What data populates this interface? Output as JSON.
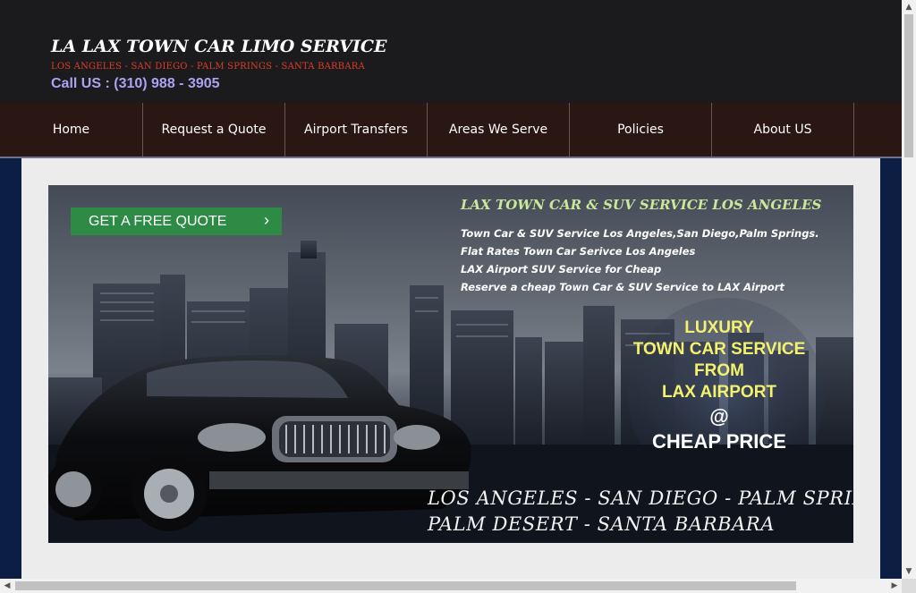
{
  "header": {
    "title": "LA LAX TOWN CAR LIMO SERVICE",
    "subtitle": "LOS ANGELES - SAN DIEGO - PALM SPRINGS - SANTA BARBARA",
    "phone": "Call US : (310) 988 - 3905"
  },
  "nav": {
    "items": [
      {
        "label": "Home"
      },
      {
        "label": "Request a Quote"
      },
      {
        "label": "Airport Transfers"
      },
      {
        "label": "Areas We Serve"
      },
      {
        "label": "Policies"
      },
      {
        "label": "About US"
      }
    ]
  },
  "banner": {
    "quote_button": "GET A FREE QUOTE",
    "promo_title": "LAX TOWN CAR & SUV SERVICE LOS ANGELES",
    "promo_lines": [
      "Town Car & SUV Service Los Angeles,San Diego,Palm Springs.",
      "Flat Rates Town Car Serivce Los Angeles",
      "LAX Airport SUV Service for Cheap",
      "Reserve a cheap Town Car & SUV Service to LAX Airport"
    ],
    "circle_lines": [
      "LUXURY",
      "TOWN CAR SERVICE",
      "FROM",
      "LAX AIRPORT"
    ],
    "circle_at": "@",
    "circle_price": "CHEAP PRICE",
    "cities_line1": "LOS ANGELES - SAN DIEGO - PALM SPRINGS",
    "cities_line2": "PALM DESERT - SANTA BARBARA"
  },
  "icons": {
    "quote_chevron": "chevron-right-icon",
    "scroll_up": "arrow-up-icon",
    "scroll_down": "arrow-down-icon",
    "scroll_left": "arrow-left-icon",
    "scroll_right": "arrow-right-icon"
  },
  "colors": {
    "header_bg": "#1b1b1d",
    "nav_bg": "#2a1613",
    "page_bg": "#0d1e45",
    "subtitle": "#e03c27",
    "phone": "#a9a3f0",
    "quote_button": "#2e8b45",
    "promo_title": "#c9e89a",
    "circle_text": "#f4f16f"
  }
}
